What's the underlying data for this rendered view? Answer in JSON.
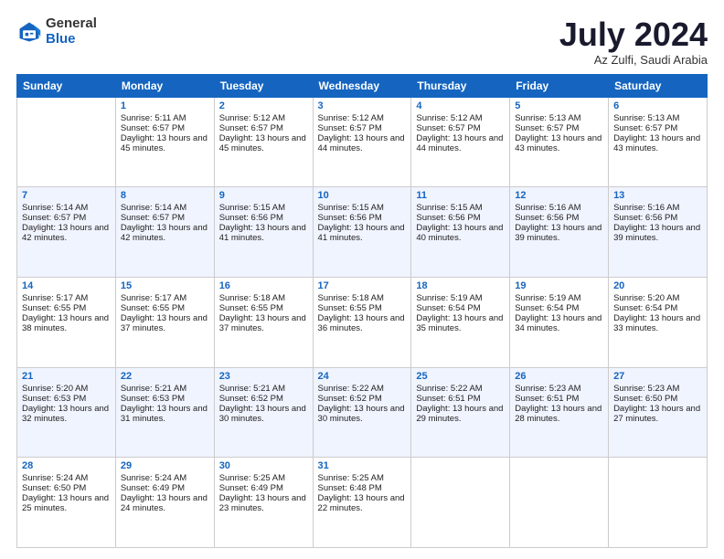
{
  "header": {
    "logo_general": "General",
    "logo_blue": "Blue",
    "month_title": "July 2024",
    "location": "Az Zulfi, Saudi Arabia"
  },
  "days_of_week": [
    "Sunday",
    "Monday",
    "Tuesday",
    "Wednesday",
    "Thursday",
    "Friday",
    "Saturday"
  ],
  "weeks": [
    [
      {
        "day": "",
        "sunrise": "",
        "sunset": "",
        "daylight": "",
        "empty": true
      },
      {
        "day": "1",
        "sunrise": "Sunrise: 5:11 AM",
        "sunset": "Sunset: 6:57 PM",
        "daylight": "Daylight: 13 hours and 45 minutes.",
        "empty": false
      },
      {
        "day": "2",
        "sunrise": "Sunrise: 5:12 AM",
        "sunset": "Sunset: 6:57 PM",
        "daylight": "Daylight: 13 hours and 45 minutes.",
        "empty": false
      },
      {
        "day": "3",
        "sunrise": "Sunrise: 5:12 AM",
        "sunset": "Sunset: 6:57 PM",
        "daylight": "Daylight: 13 hours and 44 minutes.",
        "empty": false
      },
      {
        "day": "4",
        "sunrise": "Sunrise: 5:12 AM",
        "sunset": "Sunset: 6:57 PM",
        "daylight": "Daylight: 13 hours and 44 minutes.",
        "empty": false
      },
      {
        "day": "5",
        "sunrise": "Sunrise: 5:13 AM",
        "sunset": "Sunset: 6:57 PM",
        "daylight": "Daylight: 13 hours and 43 minutes.",
        "empty": false
      },
      {
        "day": "6",
        "sunrise": "Sunrise: 5:13 AM",
        "sunset": "Sunset: 6:57 PM",
        "daylight": "Daylight: 13 hours and 43 minutes.",
        "empty": false
      }
    ],
    [
      {
        "day": "7",
        "sunrise": "Sunrise: 5:14 AM",
        "sunset": "Sunset: 6:57 PM",
        "daylight": "Daylight: 13 hours and 42 minutes.",
        "empty": false
      },
      {
        "day": "8",
        "sunrise": "Sunrise: 5:14 AM",
        "sunset": "Sunset: 6:57 PM",
        "daylight": "Daylight: 13 hours and 42 minutes.",
        "empty": false
      },
      {
        "day": "9",
        "sunrise": "Sunrise: 5:15 AM",
        "sunset": "Sunset: 6:56 PM",
        "daylight": "Daylight: 13 hours and 41 minutes.",
        "empty": false
      },
      {
        "day": "10",
        "sunrise": "Sunrise: 5:15 AM",
        "sunset": "Sunset: 6:56 PM",
        "daylight": "Daylight: 13 hours and 41 minutes.",
        "empty": false
      },
      {
        "day": "11",
        "sunrise": "Sunrise: 5:15 AM",
        "sunset": "Sunset: 6:56 PM",
        "daylight": "Daylight: 13 hours and 40 minutes.",
        "empty": false
      },
      {
        "day": "12",
        "sunrise": "Sunrise: 5:16 AM",
        "sunset": "Sunset: 6:56 PM",
        "daylight": "Daylight: 13 hours and 39 minutes.",
        "empty": false
      },
      {
        "day": "13",
        "sunrise": "Sunrise: 5:16 AM",
        "sunset": "Sunset: 6:56 PM",
        "daylight": "Daylight: 13 hours and 39 minutes.",
        "empty": false
      }
    ],
    [
      {
        "day": "14",
        "sunrise": "Sunrise: 5:17 AM",
        "sunset": "Sunset: 6:55 PM",
        "daylight": "Daylight: 13 hours and 38 minutes.",
        "empty": false
      },
      {
        "day": "15",
        "sunrise": "Sunrise: 5:17 AM",
        "sunset": "Sunset: 6:55 PM",
        "daylight": "Daylight: 13 hours and 37 minutes.",
        "empty": false
      },
      {
        "day": "16",
        "sunrise": "Sunrise: 5:18 AM",
        "sunset": "Sunset: 6:55 PM",
        "daylight": "Daylight: 13 hours and 37 minutes.",
        "empty": false
      },
      {
        "day": "17",
        "sunrise": "Sunrise: 5:18 AM",
        "sunset": "Sunset: 6:55 PM",
        "daylight": "Daylight: 13 hours and 36 minutes.",
        "empty": false
      },
      {
        "day": "18",
        "sunrise": "Sunrise: 5:19 AM",
        "sunset": "Sunset: 6:54 PM",
        "daylight": "Daylight: 13 hours and 35 minutes.",
        "empty": false
      },
      {
        "day": "19",
        "sunrise": "Sunrise: 5:19 AM",
        "sunset": "Sunset: 6:54 PM",
        "daylight": "Daylight: 13 hours and 34 minutes.",
        "empty": false
      },
      {
        "day": "20",
        "sunrise": "Sunrise: 5:20 AM",
        "sunset": "Sunset: 6:54 PM",
        "daylight": "Daylight: 13 hours and 33 minutes.",
        "empty": false
      }
    ],
    [
      {
        "day": "21",
        "sunrise": "Sunrise: 5:20 AM",
        "sunset": "Sunset: 6:53 PM",
        "daylight": "Daylight: 13 hours and 32 minutes.",
        "empty": false
      },
      {
        "day": "22",
        "sunrise": "Sunrise: 5:21 AM",
        "sunset": "Sunset: 6:53 PM",
        "daylight": "Daylight: 13 hours and 31 minutes.",
        "empty": false
      },
      {
        "day": "23",
        "sunrise": "Sunrise: 5:21 AM",
        "sunset": "Sunset: 6:52 PM",
        "daylight": "Daylight: 13 hours and 30 minutes.",
        "empty": false
      },
      {
        "day": "24",
        "sunrise": "Sunrise: 5:22 AM",
        "sunset": "Sunset: 6:52 PM",
        "daylight": "Daylight: 13 hours and 30 minutes.",
        "empty": false
      },
      {
        "day": "25",
        "sunrise": "Sunrise: 5:22 AM",
        "sunset": "Sunset: 6:51 PM",
        "daylight": "Daylight: 13 hours and 29 minutes.",
        "empty": false
      },
      {
        "day": "26",
        "sunrise": "Sunrise: 5:23 AM",
        "sunset": "Sunset: 6:51 PM",
        "daylight": "Daylight: 13 hours and 28 minutes.",
        "empty": false
      },
      {
        "day": "27",
        "sunrise": "Sunrise: 5:23 AM",
        "sunset": "Sunset: 6:50 PM",
        "daylight": "Daylight: 13 hours and 27 minutes.",
        "empty": false
      }
    ],
    [
      {
        "day": "28",
        "sunrise": "Sunrise: 5:24 AM",
        "sunset": "Sunset: 6:50 PM",
        "daylight": "Daylight: 13 hours and 25 minutes.",
        "empty": false
      },
      {
        "day": "29",
        "sunrise": "Sunrise: 5:24 AM",
        "sunset": "Sunset: 6:49 PM",
        "daylight": "Daylight: 13 hours and 24 minutes.",
        "empty": false
      },
      {
        "day": "30",
        "sunrise": "Sunrise: 5:25 AM",
        "sunset": "Sunset: 6:49 PM",
        "daylight": "Daylight: 13 hours and 23 minutes.",
        "empty": false
      },
      {
        "day": "31",
        "sunrise": "Sunrise: 5:25 AM",
        "sunset": "Sunset: 6:48 PM",
        "daylight": "Daylight: 13 hours and 22 minutes.",
        "empty": false
      },
      {
        "day": "",
        "sunrise": "",
        "sunset": "",
        "daylight": "",
        "empty": true
      },
      {
        "day": "",
        "sunrise": "",
        "sunset": "",
        "daylight": "",
        "empty": true
      },
      {
        "day": "",
        "sunrise": "",
        "sunset": "",
        "daylight": "",
        "empty": true
      }
    ]
  ],
  "row_shading": [
    false,
    true,
    false,
    true,
    false
  ]
}
